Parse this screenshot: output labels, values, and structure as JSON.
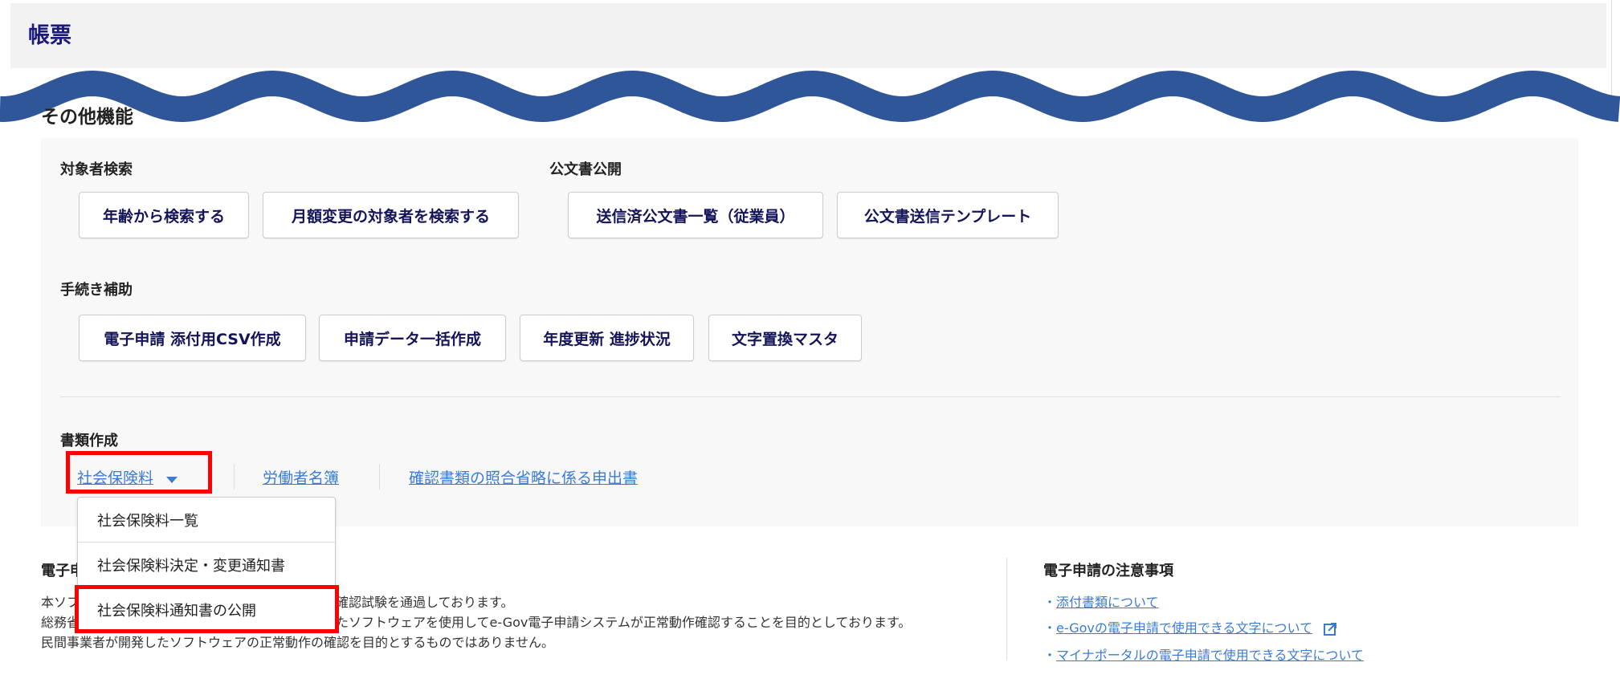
{
  "header": {
    "title": "帳票"
  },
  "wave_color": "#30569a",
  "other": {
    "title": "その他機能",
    "search": {
      "label": "対象者検索",
      "buttons": [
        "年齢から検索する",
        "月額変更の対象者を検索する"
      ]
    },
    "public_docs": {
      "label": "公文書公開",
      "buttons": [
        "送信済公文書一覧（従業員）",
        "公文書送信テンプレート"
      ]
    },
    "procedures": {
      "label": "手続き補助",
      "buttons": [
        "電子申請 添付用CSV作成",
        "申請データ一括作成",
        "年度更新 進捗状況",
        "文字置換マスタ"
      ]
    },
    "documents": {
      "label": "書類作成",
      "links": [
        "社会保険料",
        "労働者名簿",
        "確認書類の照合省略に係る申出書"
      ],
      "dropdown": [
        "社会保険料一覧",
        "社会保険料決定・変更通知書",
        "社会保険料通知書の公開"
      ]
    }
  },
  "footer_left": {
    "heading": "電子申",
    "lines": [
      {
        "left": "本ソフ",
        "right": "確認試験を通過しております。"
      },
      {
        "left": "総務省",
        "right": "たソフトウェアを使用してe-Gov電子申請システムが正常動作確認することを目的としております。"
      },
      {
        "left": "民間事業者が開発したソフトウェアの正常動作の確認を目的とするものではありません。",
        "right": ""
      }
    ]
  },
  "footer_right": {
    "heading": "電子申請の注意事項",
    "bullet": "・",
    "links": [
      "添付書類について",
      "e-Govの電子申請で使用できる文字について",
      "マイナポータルの電子申請で使用できる文字について"
    ]
  }
}
